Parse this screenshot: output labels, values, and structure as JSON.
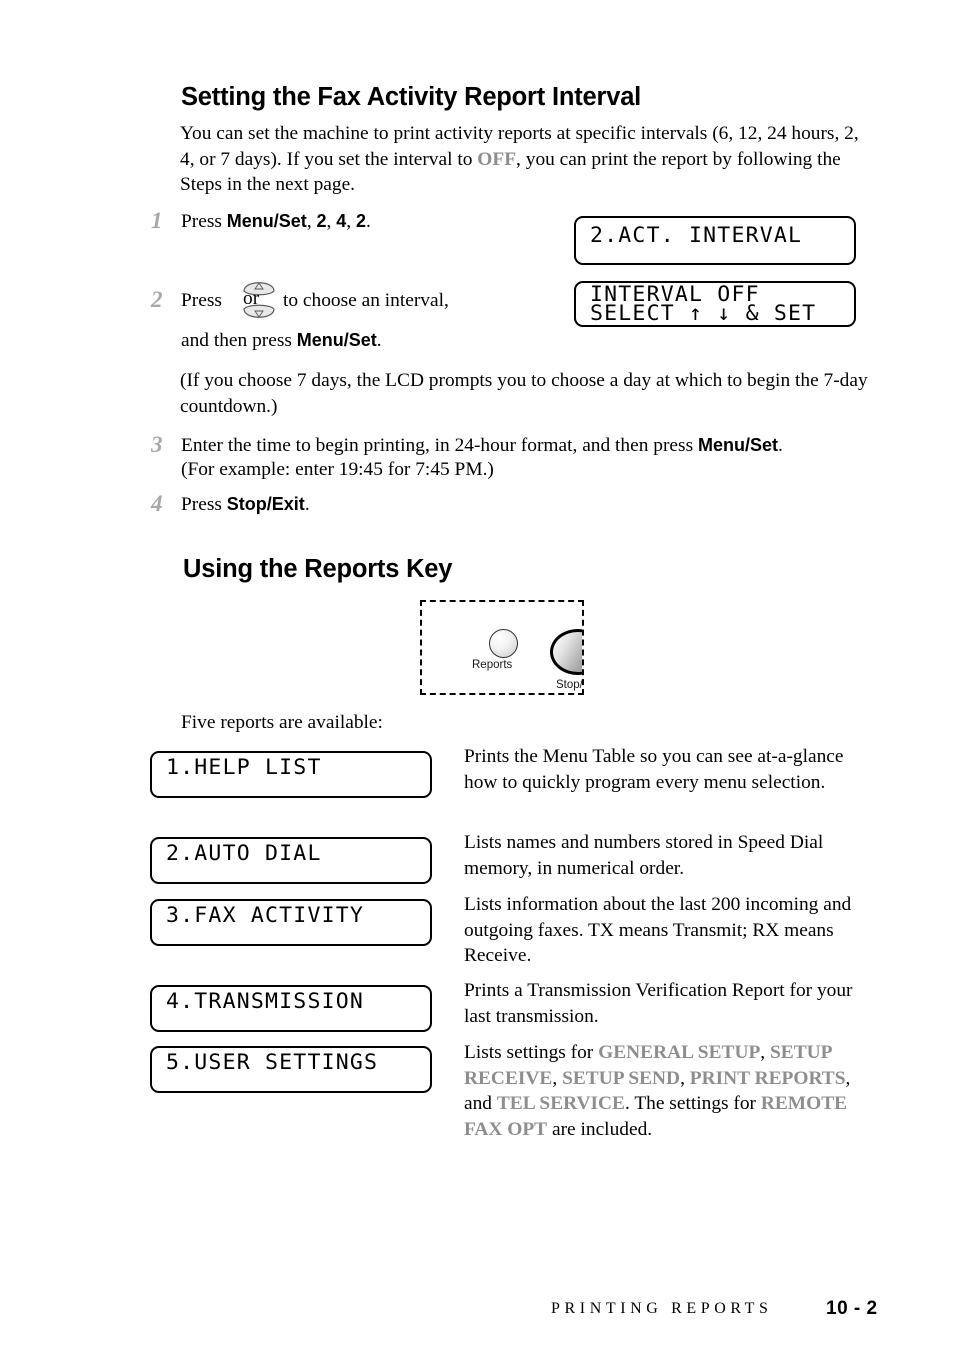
{
  "page": {
    "section1_heading": "Setting the Fax Activity Report Interval",
    "section1_intro_pre": "You can set the machine to print activity reports at specific intervals (6, 12, 24 hours, 2, 4, or 7 days). If you set the interval to ",
    "section1_intro_term": "OFF",
    "section1_intro_post": ", you can print the report by following the Steps in the next page.",
    "section2_heading": "Using the Reports Key",
    "five_reports_line": "Five reports are available:"
  },
  "steps": [
    {
      "number": "1",
      "pre": "Press ",
      "bold1": "Menu/Set",
      "mid1": ", ",
      "bold2": "2",
      "mid2": ", ",
      "bold3": "4",
      "mid3": ", ",
      "bold4": "2",
      "post": "."
    },
    {
      "number": "2",
      "line1_pre": "Press ",
      "line1_post": " to choose an interval,",
      "line2_pre": "and then press ",
      "line2_bold": "Menu/Set",
      "line2_post": ".",
      "note": "(If you choose 7 days, the LCD prompts you to choose a day at which to begin the 7-day countdown.)"
    },
    {
      "number": "3",
      "pre": "Enter the time to begin printing, in 24-hour format, and then press ",
      "bold": "Menu/Set",
      "post": ".",
      "line2": "(For example: enter 19:45 for 7:45 PM.)"
    },
    {
      "number": "4",
      "pre": "Press ",
      "bold": "Stop/Exit",
      "post": "."
    }
  ],
  "lcd_panels": {
    "act_interval": {
      "line1": "2.ACT. INTERVAL",
      "line2": ""
    },
    "interval_off": {
      "line1": "INTERVAL OFF",
      "line2": "SELECT ↑ ↓ & SET"
    }
  },
  "updown_key": {
    "or_label": "or",
    "up_glyph": "△",
    "down_glyph": "▽"
  },
  "illustration": {
    "reports_button_label": "Reports",
    "stop_button_label": "Stop/"
  },
  "reports": [
    {
      "lcd": "1.HELP LIST",
      "description": "Prints the Menu Table so you can see at-a-glance how to quickly program every menu selection."
    },
    {
      "lcd": "2.AUTO DIAL",
      "description": "Lists names and numbers stored in Speed Dial memory, in numerical order."
    },
    {
      "lcd": "3.FAX ACTIVITY",
      "description": "Lists information about the last 200 incoming and outgoing faxes. TX means Transmit; RX means Receive."
    },
    {
      "lcd": "4.TRANSMISSION",
      "description": "Prints a Transmission Verification Report for your last transmission."
    },
    {
      "lcd": "5.USER SETTINGS",
      "description_parts": {
        "p1": "Lists settings for ",
        "t1": "GENERAL SETUP",
        "p2": ", ",
        "t2": "SETUP RECEIVE",
        "p3": ", ",
        "t3": "SETUP SEND",
        "p4": ", ",
        "t4": "PRINT REPORTS",
        "p5": ", and ",
        "t5": "TEL SERVICE",
        "p6": ". The settings for ",
        "t6": "REMOTE FAX OPT",
        "p7": " are included."
      }
    }
  ],
  "footer": {
    "title": "PRINTING REPORTS",
    "page_number": "10 - 2"
  },
  "colors": {
    "gray_term": "#8e8e8e",
    "step_number": "#a8a8a8",
    "text": "#000000"
  }
}
